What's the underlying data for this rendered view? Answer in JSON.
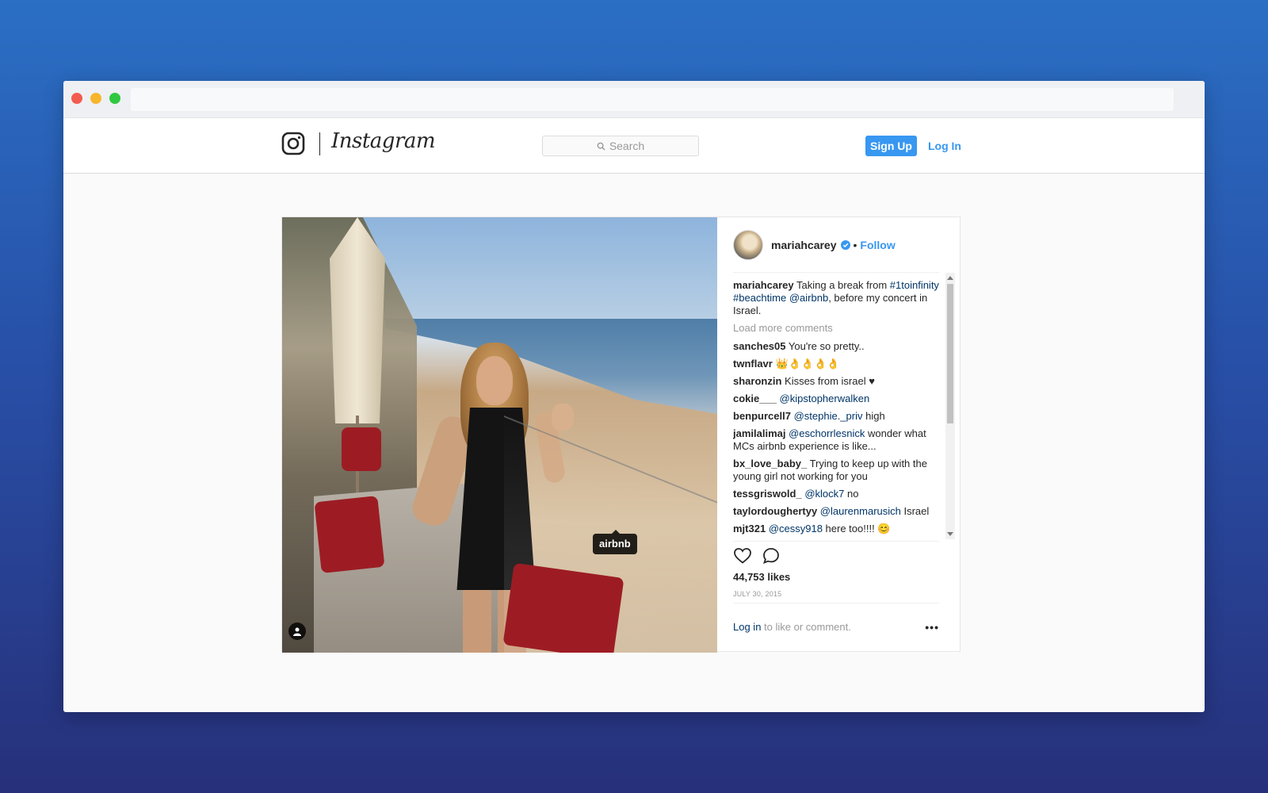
{
  "header": {
    "logo_text": "Instagram",
    "search_placeholder": "Search",
    "signup_label": "Sign Up",
    "login_label": "Log In"
  },
  "post": {
    "photo_tag": "airbnb",
    "username": "mariahcarey",
    "follow_label": "Follow",
    "separator": "•",
    "caption": {
      "user": "mariahcarey",
      "text1": " Taking a break from ",
      "tag1": "#1toinfinity",
      "space1": " ",
      "tag2": "#beachtime",
      "space2": " ",
      "mention": "@airbnb",
      "text2": ", before my concert in Israel."
    },
    "load_more": "Load more comments",
    "comments": [
      {
        "user": "sanches05",
        "mention": "",
        "text": " You're so pretty.."
      },
      {
        "user": "twnflavr",
        "mention": "",
        "text": " 👑👌👌👌👌"
      },
      {
        "user": "sharonzin",
        "mention": "",
        "text": " Kisses from israel ♥"
      },
      {
        "user": "cokie___",
        "mention": " @kipstopherwalken",
        "text": ""
      },
      {
        "user": "benpurcell7",
        "mention": " @stephie._priv",
        "text": " high"
      },
      {
        "user": "jamilalimaj",
        "mention": " @eschorrlesnick",
        "text": " wonder what MCs airbnb experience is like..."
      },
      {
        "user": "bx_love_baby_",
        "mention": "",
        "text": " Trying to keep up with the young girl not working for you"
      },
      {
        "user": "tessgriswold_",
        "mention": " @klock7",
        "text": " no"
      },
      {
        "user": "taylordoughertyy",
        "mention": " @laurenmarusich",
        "text": " Israel"
      },
      {
        "user": "mjt321",
        "mention": " @cessy918",
        "text": " here too!!!! 😊"
      }
    ],
    "likes": "44,753 likes",
    "date": "JULY 30, 2015",
    "footer": {
      "login_link": "Log in",
      "rest": " to like or comment.",
      "more": "•••"
    }
  },
  "colors": {
    "accent": "#3897f0",
    "link": "#003569",
    "tag_bg": "#000000"
  }
}
